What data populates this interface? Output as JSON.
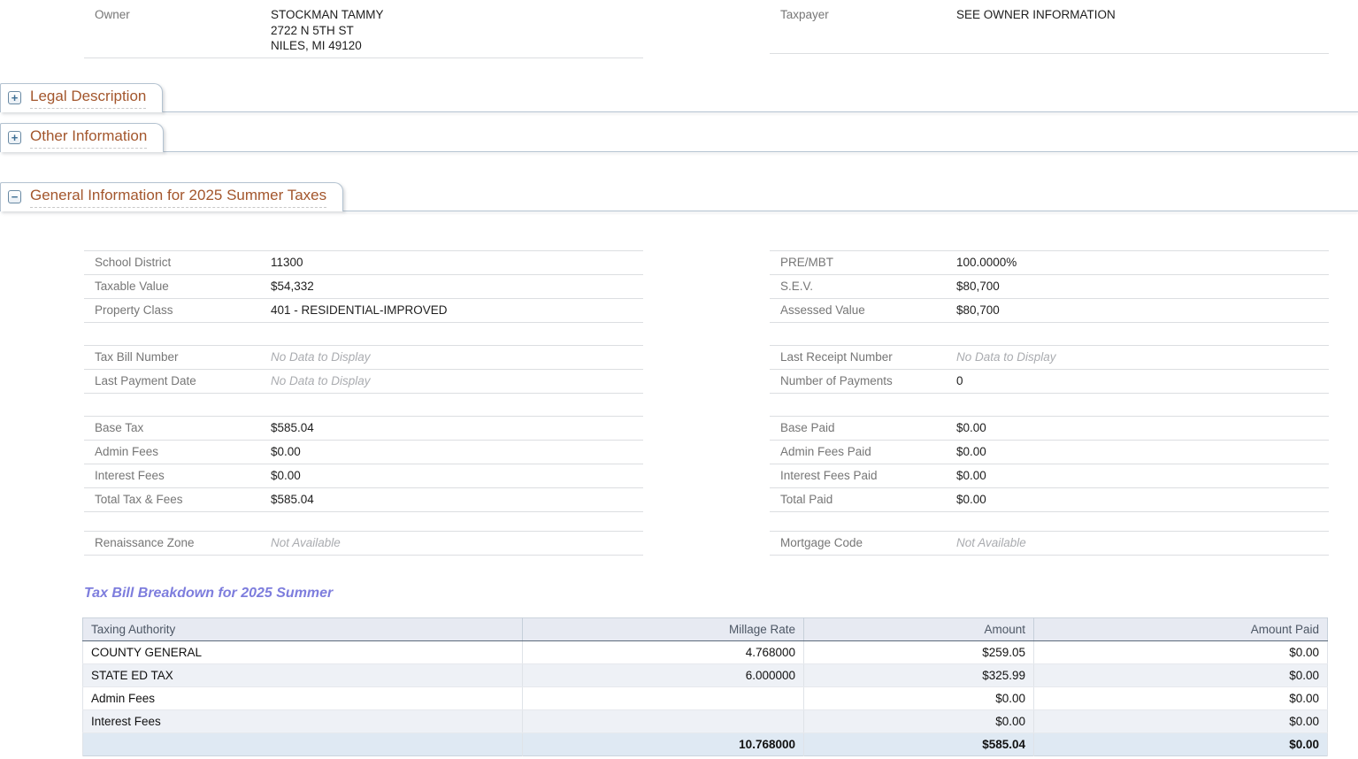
{
  "owner_section": {
    "owner": {
      "label": "Owner",
      "lines": [
        "STOCKMAN TAMMY",
        "2722 N 5TH ST",
        "NILES, MI 49120"
      ]
    },
    "taxpayer": {
      "label": "Taxpayer",
      "value": "SEE OWNER INFORMATION"
    }
  },
  "tabs": [
    {
      "title": "Legal Description",
      "state": "collapsed",
      "icon_glyph": "+"
    },
    {
      "title": "Other Information",
      "state": "collapsed",
      "icon_glyph": "+"
    },
    {
      "title": "General Information for 2025 Summer Taxes",
      "state": "expanded",
      "icon_glyph": "−"
    }
  ],
  "general": {
    "school_district": {
      "label": "School District",
      "value": "11300"
    },
    "taxable_value": {
      "label": "Taxable Value",
      "value": "$54,332"
    },
    "property_class": {
      "label": "Property Class",
      "value": "401 - RESIDENTIAL-IMPROVED"
    },
    "tax_bill_number": {
      "label": "Tax Bill Number",
      "value": "No Data to Display"
    },
    "last_payment_date": {
      "label": "Last Payment Date",
      "value": "No Data to Display"
    },
    "base_tax": {
      "label": "Base Tax",
      "value": "$585.04"
    },
    "admin_fees": {
      "label": "Admin Fees",
      "value": "$0.00"
    },
    "interest_fees": {
      "label": "Interest Fees",
      "value": "$0.00"
    },
    "total_tax_fees": {
      "label": "Total Tax & Fees",
      "value": "$585.04"
    },
    "renaissance_zone": {
      "label": "Renaissance Zone",
      "value": "Not Available"
    },
    "pre_mbt": {
      "label": "PRE/MBT",
      "value": "100.0000%"
    },
    "sev": {
      "label": "S.E.V.",
      "value": "$80,700"
    },
    "assessed_value": {
      "label": "Assessed Value",
      "value": "$80,700"
    },
    "last_receipt_number": {
      "label": "Last Receipt Number",
      "value": "No Data to Display"
    },
    "number_of_payments": {
      "label": "Number of Payments",
      "value": "0"
    },
    "base_paid": {
      "label": "Base Paid",
      "value": "$0.00"
    },
    "admin_fees_paid": {
      "label": "Admin Fees Paid",
      "value": "$0.00"
    },
    "interest_fees_paid": {
      "label": "Interest Fees Paid",
      "value": "$0.00"
    },
    "total_paid": {
      "label": "Total Paid",
      "value": "$0.00"
    },
    "mortgage_code": {
      "label": "Mortgage Code",
      "value": "Not Available"
    }
  },
  "breakdown": {
    "heading": "Tax Bill Breakdown for 2025 Summer",
    "columns": [
      "Taxing Authority",
      "Millage Rate",
      "Amount",
      "Amount Paid"
    ],
    "rows": [
      {
        "authority": "COUNTY GENERAL",
        "millage": "4.768000",
        "amount": "$259.05",
        "amount_paid": "$0.00"
      },
      {
        "authority": "STATE ED TAX",
        "millage": "6.000000",
        "amount": "$325.99",
        "amount_paid": "$0.00"
      },
      {
        "authority": "Admin Fees",
        "millage": "",
        "amount": "$0.00",
        "amount_paid": "$0.00"
      },
      {
        "authority": "Interest Fees",
        "millage": "",
        "amount": "$0.00",
        "amount_paid": "$0.00"
      }
    ],
    "total": {
      "authority": "",
      "millage": "10.768000",
      "amount": "$585.04",
      "amount_paid": "$0.00"
    }
  },
  "colors": {
    "tab_title": "#a3562c",
    "tab_border": "#b3c2d0",
    "toggle_icon_blue": "#3e6f94",
    "heading_purple": "#7d7ddd",
    "label_gray": "#767676",
    "muted_gray": "#aaacb0",
    "table_header_bg": "#e7eaf2",
    "table_alt_row_bg": "#eef1f6",
    "table_total_row_bg": "#dfe9f3",
    "table_header_border_dark": "#5c6b7b"
  }
}
